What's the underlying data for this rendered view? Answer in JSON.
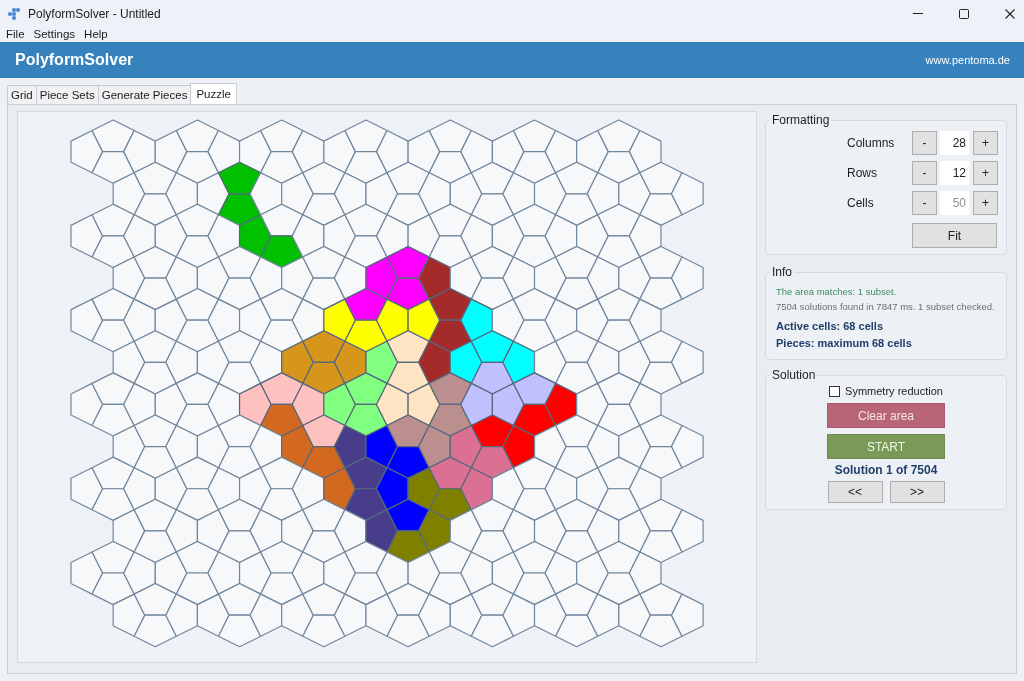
{
  "window": {
    "title": "PolyformSolver - Untitled"
  },
  "menu": [
    "File",
    "Settings",
    "Help"
  ],
  "header": {
    "title": "PolyformSolver",
    "website": "www.pentoma.de"
  },
  "tabs": [
    {
      "label": "Grid",
      "selected": false
    },
    {
      "label": "Piece Sets",
      "selected": false
    },
    {
      "label": "Generate Pieces",
      "selected": false
    },
    {
      "label": "Puzzle",
      "selected": true
    }
  ],
  "board": {
    "rows": [
      [
        {
          "filled": false
        },
        {
          "filled": false
        },
        {
          "filled": false
        },
        {
          "filled": false
        },
        {
          "filled": false
        },
        {
          "filled": false
        },
        {
          "filled": false
        },
        {
          "filled": false
        },
        {
          "filled": false
        },
        {
          "filled": false
        },
        {
          "filled": false
        },
        {
          "filled": false
        },
        {
          "filled": false
        },
        {
          "filled": false
        },
        {
          "filled": false
        },
        {
          "filled": false
        },
        {
          "filled": false
        },
        {
          "filled": false
        },
        {
          "filled": false
        },
        {
          "filled": false
        },
        {
          "filled": false
        },
        {
          "filled": false
        },
        {
          "filled": false
        },
        {
          "filled": false
        },
        {
          "filled": false
        },
        {
          "filled": false
        },
        {
          "filled": false
        },
        {
          "filled": false
        }
      ],
      [
        {
          "filled": false
        },
        {
          "filled": false
        },
        {
          "filled": false
        },
        {
          "filled": false
        },
        {
          "filled": false
        },
        {
          "filled": true,
          "color": "#00c000"
        },
        {
          "filled": true,
          "color": "#00c000"
        },
        {
          "filled": false
        },
        {
          "filled": false
        },
        {
          "filled": false
        },
        {
          "filled": false
        },
        {
          "filled": false
        },
        {
          "filled": false
        },
        {
          "filled": false
        },
        {
          "filled": false
        },
        {
          "filled": false
        },
        {
          "filled": false
        },
        {
          "filled": false
        },
        {
          "filled": false
        },
        {
          "filled": false
        },
        {
          "filled": false
        },
        {
          "filled": false
        },
        {
          "filled": false
        },
        {
          "filled": false
        },
        {
          "filled": false
        },
        {
          "filled": false
        },
        {
          "filled": false
        },
        {
          "filled": false
        }
      ],
      [
        {
          "filled": false
        },
        {
          "filled": false
        },
        {
          "filled": false
        },
        {
          "filled": false
        },
        {
          "filled": false
        },
        {
          "filled": false
        },
        {
          "filled": false
        },
        {
          "filled": false
        },
        {
          "filled": true,
          "color": "#00c000"
        },
        {
          "filled": false
        },
        {
          "filled": true,
          "color": "#00c000"
        },
        {
          "filled": false
        },
        {
          "filled": false
        },
        {
          "filled": false
        },
        {
          "filled": false
        },
        {
          "filled": false
        },
        {
          "filled": false
        },
        {
          "filled": false
        },
        {
          "filled": false
        },
        {
          "filled": false
        },
        {
          "filled": false
        },
        {
          "filled": false
        },
        {
          "filled": false
        },
        {
          "filled": false
        },
        {
          "filled": false
        },
        {
          "filled": false
        },
        {
          "filled": false
        },
        {
          "filled": false
        }
      ],
      [
        {
          "filled": false
        },
        {
          "filled": false
        },
        {
          "filled": false
        },
        {
          "filled": false
        },
        {
          "filled": false
        },
        {
          "filled": false
        },
        {
          "filled": false
        },
        {
          "filled": false
        },
        {
          "filled": false
        },
        {
          "filled": false
        },
        {
          "filled": false
        },
        {
          "filled": false
        },
        {
          "filled": true,
          "color": "#ff00ff"
        },
        {
          "filled": true,
          "color": "#ff00ff"
        },
        {
          "filled": true,
          "color": "#ff00ff"
        },
        {
          "filled": true,
          "color": "#a52a2a"
        },
        {
          "filled": false
        },
        {
          "filled": false
        },
        {
          "filled": false
        },
        {
          "filled": false
        },
        {
          "filled": false
        },
        {
          "filled": false
        },
        {
          "filled": false
        },
        {
          "filled": false
        },
        {
          "filled": false
        },
        {
          "filled": false
        },
        {
          "filled": false
        },
        {
          "filled": false
        }
      ],
      [
        {
          "filled": false
        },
        {
          "filled": false
        },
        {
          "filled": false
        },
        {
          "filled": false
        },
        {
          "filled": false
        },
        {
          "filled": false
        },
        {
          "filled": false
        },
        {
          "filled": false
        },
        {
          "filled": false
        },
        {
          "filled": false
        },
        {
          "filled": false
        },
        {
          "filled": false
        },
        {
          "filled": true,
          "color": "#ffff00"
        },
        {
          "filled": true,
          "color": "#ff00ff"
        },
        {
          "filled": true,
          "color": "#ffff00"
        },
        {
          "filled": true,
          "color": "#ffff00"
        },
        {
          "filled": true,
          "color": "#ffff00"
        },
        {
          "filled": true,
          "color": "#a52a2a"
        },
        {
          "filled": true,
          "color": "#a52a2a"
        },
        {
          "filled": true,
          "color": "#00ffff"
        },
        {
          "filled": false
        },
        {
          "filled": false
        },
        {
          "filled": false
        },
        {
          "filled": false
        },
        {
          "filled": false
        },
        {
          "filled": false
        },
        {
          "filled": false
        },
        {
          "filled": false
        }
      ],
      [
        {
          "filled": false
        },
        {
          "filled": false
        },
        {
          "filled": false
        },
        {
          "filled": false
        },
        {
          "filled": false
        },
        {
          "filled": false
        },
        {
          "filled": false
        },
        {
          "filled": false
        },
        {
          "filled": true,
          "color": "#d6961c"
        },
        {
          "filled": true,
          "color": "#d6961c"
        },
        {
          "filled": true,
          "color": "#d6961c"
        },
        {
          "filled": true,
          "color": "#d6961c"
        },
        {
          "filled": true,
          "color": "#80ff80"
        },
        {
          "filled": true,
          "color": "#ffe4c4"
        },
        {
          "filled": true,
          "color": "#ffe4c4"
        },
        {
          "filled": true,
          "color": "#a52a2a"
        },
        {
          "filled": true,
          "color": "#00ffff"
        },
        {
          "filled": true,
          "color": "#00ffff"
        },
        {
          "filled": true,
          "color": "#c0c0ff"
        },
        {
          "filled": true,
          "color": "#00ffff"
        },
        {
          "filled": false
        },
        {
          "filled": false
        },
        {
          "filled": false
        },
        {
          "filled": false
        },
        {
          "filled": false
        },
        {
          "filled": false
        },
        {
          "filled": false
        },
        {
          "filled": false
        }
      ],
      [
        {
          "filled": false
        },
        {
          "filled": false
        },
        {
          "filled": false
        },
        {
          "filled": false
        },
        {
          "filled": false
        },
        {
          "filled": false
        },
        {
          "filled": false
        },
        {
          "filled": false
        },
        {
          "filled": true,
          "color": "#ffc0c0"
        },
        {
          "filled": true,
          "color": "#ffc0c0"
        },
        {
          "filled": true,
          "color": "#d2691e"
        },
        {
          "filled": true,
          "color": "#ffc0c0"
        },
        {
          "filled": true,
          "color": "#80ff80"
        },
        {
          "filled": true,
          "color": "#80ff80"
        },
        {
          "filled": true,
          "color": "#80ff80"
        },
        {
          "filled": true,
          "color": "#ffe4c4"
        },
        {
          "filled": true,
          "color": "#ffe4c4"
        },
        {
          "filled": true,
          "color": "#bc8f8f"
        },
        {
          "filled": true,
          "color": "#bc8f8f"
        },
        {
          "filled": true,
          "color": "#c0c0ff"
        },
        {
          "filled": true,
          "color": "#c0c0ff"
        },
        {
          "filled": true,
          "color": "#c0c0ff"
        },
        {
          "filled": true,
          "color": "#ff0000"
        },
        {
          "filled": true,
          "color": "#ff0000"
        },
        {
          "filled": false
        },
        {
          "filled": false
        },
        {
          "filled": false
        },
        {
          "filled": false
        }
      ],
      [
        {
          "filled": false
        },
        {
          "filled": false
        },
        {
          "filled": false
        },
        {
          "filled": false
        },
        {
          "filled": false
        },
        {
          "filled": false
        },
        {
          "filled": false
        },
        {
          "filled": false
        },
        {
          "filled": true,
          "color": "#d2691e"
        },
        {
          "filled": true,
          "color": "#ffc0c0"
        },
        {
          "filled": true,
          "color": "#d2691e"
        },
        {
          "filled": true,
          "color": "#483d8b"
        },
        {
          "filled": true,
          "color": "#0000ff"
        },
        {
          "filled": true,
          "color": "#bc8f8f"
        },
        {
          "filled": true,
          "color": "#0000ff"
        },
        {
          "filled": true,
          "color": "#bc8f8f"
        },
        {
          "filled": true,
          "color": "#db7093"
        },
        {
          "filled": true,
          "color": "#ff0000"
        },
        {
          "filled": true,
          "color": "#db7093"
        },
        {
          "filled": true,
          "color": "#ff0000"
        },
        {
          "filled": false
        },
        {
          "filled": false
        },
        {
          "filled": false
        },
        {
          "filled": false
        },
        {
          "filled": false
        },
        {
          "filled": false
        },
        {
          "filled": false
        },
        {
          "filled": false
        }
      ],
      [
        {
          "filled": false
        },
        {
          "filled": false
        },
        {
          "filled": false
        },
        {
          "filled": false
        },
        {
          "filled": false
        },
        {
          "filled": false
        },
        {
          "filled": false
        },
        {
          "filled": false
        },
        {
          "filled": false
        },
        {
          "filled": false
        },
        {
          "filled": false
        },
        {
          "filled": false
        },
        {
          "filled": true,
          "color": "#d2691e"
        },
        {
          "filled": true,
          "color": "#483d8b"
        },
        {
          "filled": true,
          "color": "#483d8b"
        },
        {
          "filled": true,
          "color": "#0000ff"
        },
        {
          "filled": true,
          "color": "#808000"
        },
        {
          "filled": true,
          "color": "#db7093"
        },
        {
          "filled": true,
          "color": "#808000"
        },
        {
          "filled": true,
          "color": "#db7093"
        },
        {
          "filled": false
        },
        {
          "filled": false
        },
        {
          "filled": false
        },
        {
          "filled": false
        },
        {
          "filled": false
        },
        {
          "filled": false
        },
        {
          "filled": false
        },
        {
          "filled": false
        }
      ],
      [
        {
          "filled": false
        },
        {
          "filled": false
        },
        {
          "filled": false
        },
        {
          "filled": false
        },
        {
          "filled": false
        },
        {
          "filled": false
        },
        {
          "filled": false
        },
        {
          "filled": false
        },
        {
          "filled": false
        },
        {
          "filled": false
        },
        {
          "filled": false
        },
        {
          "filled": false
        },
        {
          "filled": true,
          "color": "#483d8b"
        },
        {
          "filled": true,
          "color": "#0000ff"
        },
        {
          "filled": true,
          "color": "#808000"
        },
        {
          "filled": true,
          "color": "#808000"
        },
        {
          "filled": false
        },
        {
          "filled": false
        },
        {
          "filled": false
        },
        {
          "filled": false
        },
        {
          "filled": false
        },
        {
          "filled": false
        },
        {
          "filled": false
        },
        {
          "filled": false
        },
        {
          "filled": false
        },
        {
          "filled": false
        },
        {
          "filled": false
        },
        {
          "filled": false
        }
      ],
      [
        {
          "filled": false
        },
        {
          "filled": false
        },
        {
          "filled": false
        },
        {
          "filled": false
        },
        {
          "filled": false
        },
        {
          "filled": false
        },
        {
          "filled": false
        },
        {
          "filled": false
        },
        {
          "filled": false
        },
        {
          "filled": false
        },
        {
          "filled": false
        },
        {
          "filled": false
        },
        {
          "filled": false
        },
        {
          "filled": false
        },
        {
          "filled": false
        },
        {
          "filled": false
        },
        {
          "filled": false
        },
        {
          "filled": false
        },
        {
          "filled": false
        },
        {
          "filled": false
        },
        {
          "filled": false
        },
        {
          "filled": false
        },
        {
          "filled": false
        },
        {
          "filled": false
        },
        {
          "filled": false
        },
        {
          "filled": false
        },
        {
          "filled": false
        },
        {
          "filled": false
        }
      ],
      [
        {
          "filled": false
        },
        {
          "filled": false
        },
        {
          "filled": false
        },
        {
          "filled": false
        },
        {
          "filled": false
        },
        {
          "filled": false
        },
        {
          "filled": false
        },
        {
          "filled": false
        },
        {
          "filled": false
        },
        {
          "filled": false
        },
        {
          "filled": false
        },
        {
          "filled": false
        },
        {
          "filled": false
        },
        {
          "filled": false
        },
        {
          "filled": false
        },
        {
          "filled": false
        },
        {
          "filled": false
        },
        {
          "filled": false
        },
        {
          "filled": false
        },
        {
          "filled": false
        },
        {
          "filled": false
        },
        {
          "filled": false
        },
        {
          "filled": false
        },
        {
          "filled": false
        },
        {
          "filled": false
        },
        {
          "filled": false
        },
        {
          "filled": false
        },
        {
          "filled": false
        }
      ]
    ]
  },
  "formatting": {
    "title": "Formatting",
    "fields": [
      {
        "label": "Columns",
        "decrement": "-",
        "value": "28",
        "increment": "+",
        "disabled": false
      },
      {
        "label": "Rows",
        "decrement": "-",
        "value": "12",
        "increment": "+",
        "disabled": false
      },
      {
        "label": "Cells",
        "decrement": "-",
        "value": "50",
        "increment": "+",
        "disabled": true
      }
    ],
    "fit_button": "Fit"
  },
  "info": {
    "title": "Info",
    "lines": [
      {
        "kind": "status",
        "text": "The area matches: 1 subset."
      },
      {
        "kind": "detail",
        "text": "7504 solutions found in 7847 ms. 1 subset checked."
      },
      {
        "kind": "summary",
        "text": "Active cells: 68 cells"
      },
      {
        "kind": "summary",
        "text": "Pieces: maximum 68 cells"
      }
    ]
  },
  "solution": {
    "title": "Solution",
    "symmetry_reduction": {
      "label": "Symmetry reduction",
      "checked": false
    },
    "clear_button": "Clear area",
    "start_button": "START",
    "counter": "Solution 1 of 7504",
    "previous_button": "<<",
    "next_button": ">>"
  }
}
